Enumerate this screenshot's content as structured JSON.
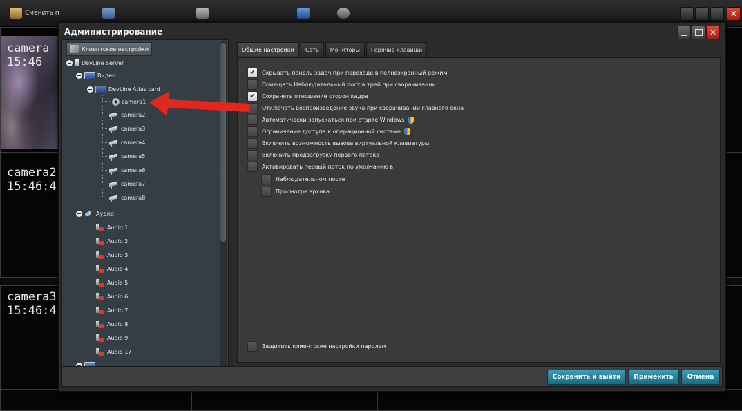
{
  "toolbar": {
    "change_user_label": "Сменить п",
    "close_icon": "close-icon"
  },
  "cameras": [
    {
      "name": "camera",
      "time": "15:46"
    },
    {
      "name": "camera2",
      "time": "15:46:4"
    },
    {
      "name": "camera3",
      "time": "15:46:4"
    }
  ],
  "dialog": {
    "title": "Администрирование",
    "close_glyph": "✕"
  },
  "tree": {
    "header": "Клиентские настройки",
    "server": "DevLine Server",
    "video": "Видео",
    "card": "DevLine Atlas card",
    "cameras": [
      "camera1",
      "camera2",
      "camera3",
      "camera4",
      "camera5",
      "camera6",
      "camera7",
      "camera8"
    ],
    "audio_group": "Аудио",
    "audio": [
      "Audio 1",
      "Audio 2",
      "Audio 3",
      "Audio 4",
      "Audio 5",
      "Audio 6",
      "Audio 7",
      "Audio 8",
      "Audio 9",
      "Audio 17"
    ]
  },
  "tabs": [
    "Общие настройки",
    "Сеть",
    "Мониторы",
    "Горячие клавиши"
  ],
  "options": [
    {
      "label": "Скрывать панель задач при переходе в полноэкранный режим",
      "checked": true,
      "shield": false
    },
    {
      "label": "Помещать Наблюдательный пост в трей при сворачивании",
      "checked": false,
      "shield": false
    },
    {
      "label": "Сохранять отношение сторон кадра",
      "checked": true,
      "shield": false
    },
    {
      "label": "Отключать воспроизведение звука при сворачивании главного окна",
      "checked": false,
      "shield": false
    },
    {
      "label": "Автоматически запускаться при старте Windows",
      "checked": false,
      "shield": true
    },
    {
      "label": "Ограничение доступа к операционной системе",
      "checked": false,
      "shield": true
    },
    {
      "label": "Включить возможность вызова виртуальной клавиатуры",
      "checked": false,
      "shield": false
    },
    {
      "label": "Включить предзагрузку первого потока",
      "checked": false,
      "shield": false
    },
    {
      "label": "Активировать первый поток по умолчанию в:",
      "checked": false,
      "shield": false
    }
  ],
  "sub_options": [
    {
      "label": "Наблюдательном посте",
      "checked": false
    },
    {
      "label": "Просмотре архива",
      "checked": false
    }
  ],
  "protect_option": {
    "label": "Защитить клиентские настройки паролем",
    "checked": false
  },
  "buttons": {
    "save_exit": "Сохранить и выйти",
    "apply": "Применить",
    "cancel": "Отмена"
  },
  "colors": {
    "accent_button": "#2a86a0",
    "arrow": "#e0281e",
    "close_button": "#c8321f"
  },
  "check_glyph": "✔"
}
